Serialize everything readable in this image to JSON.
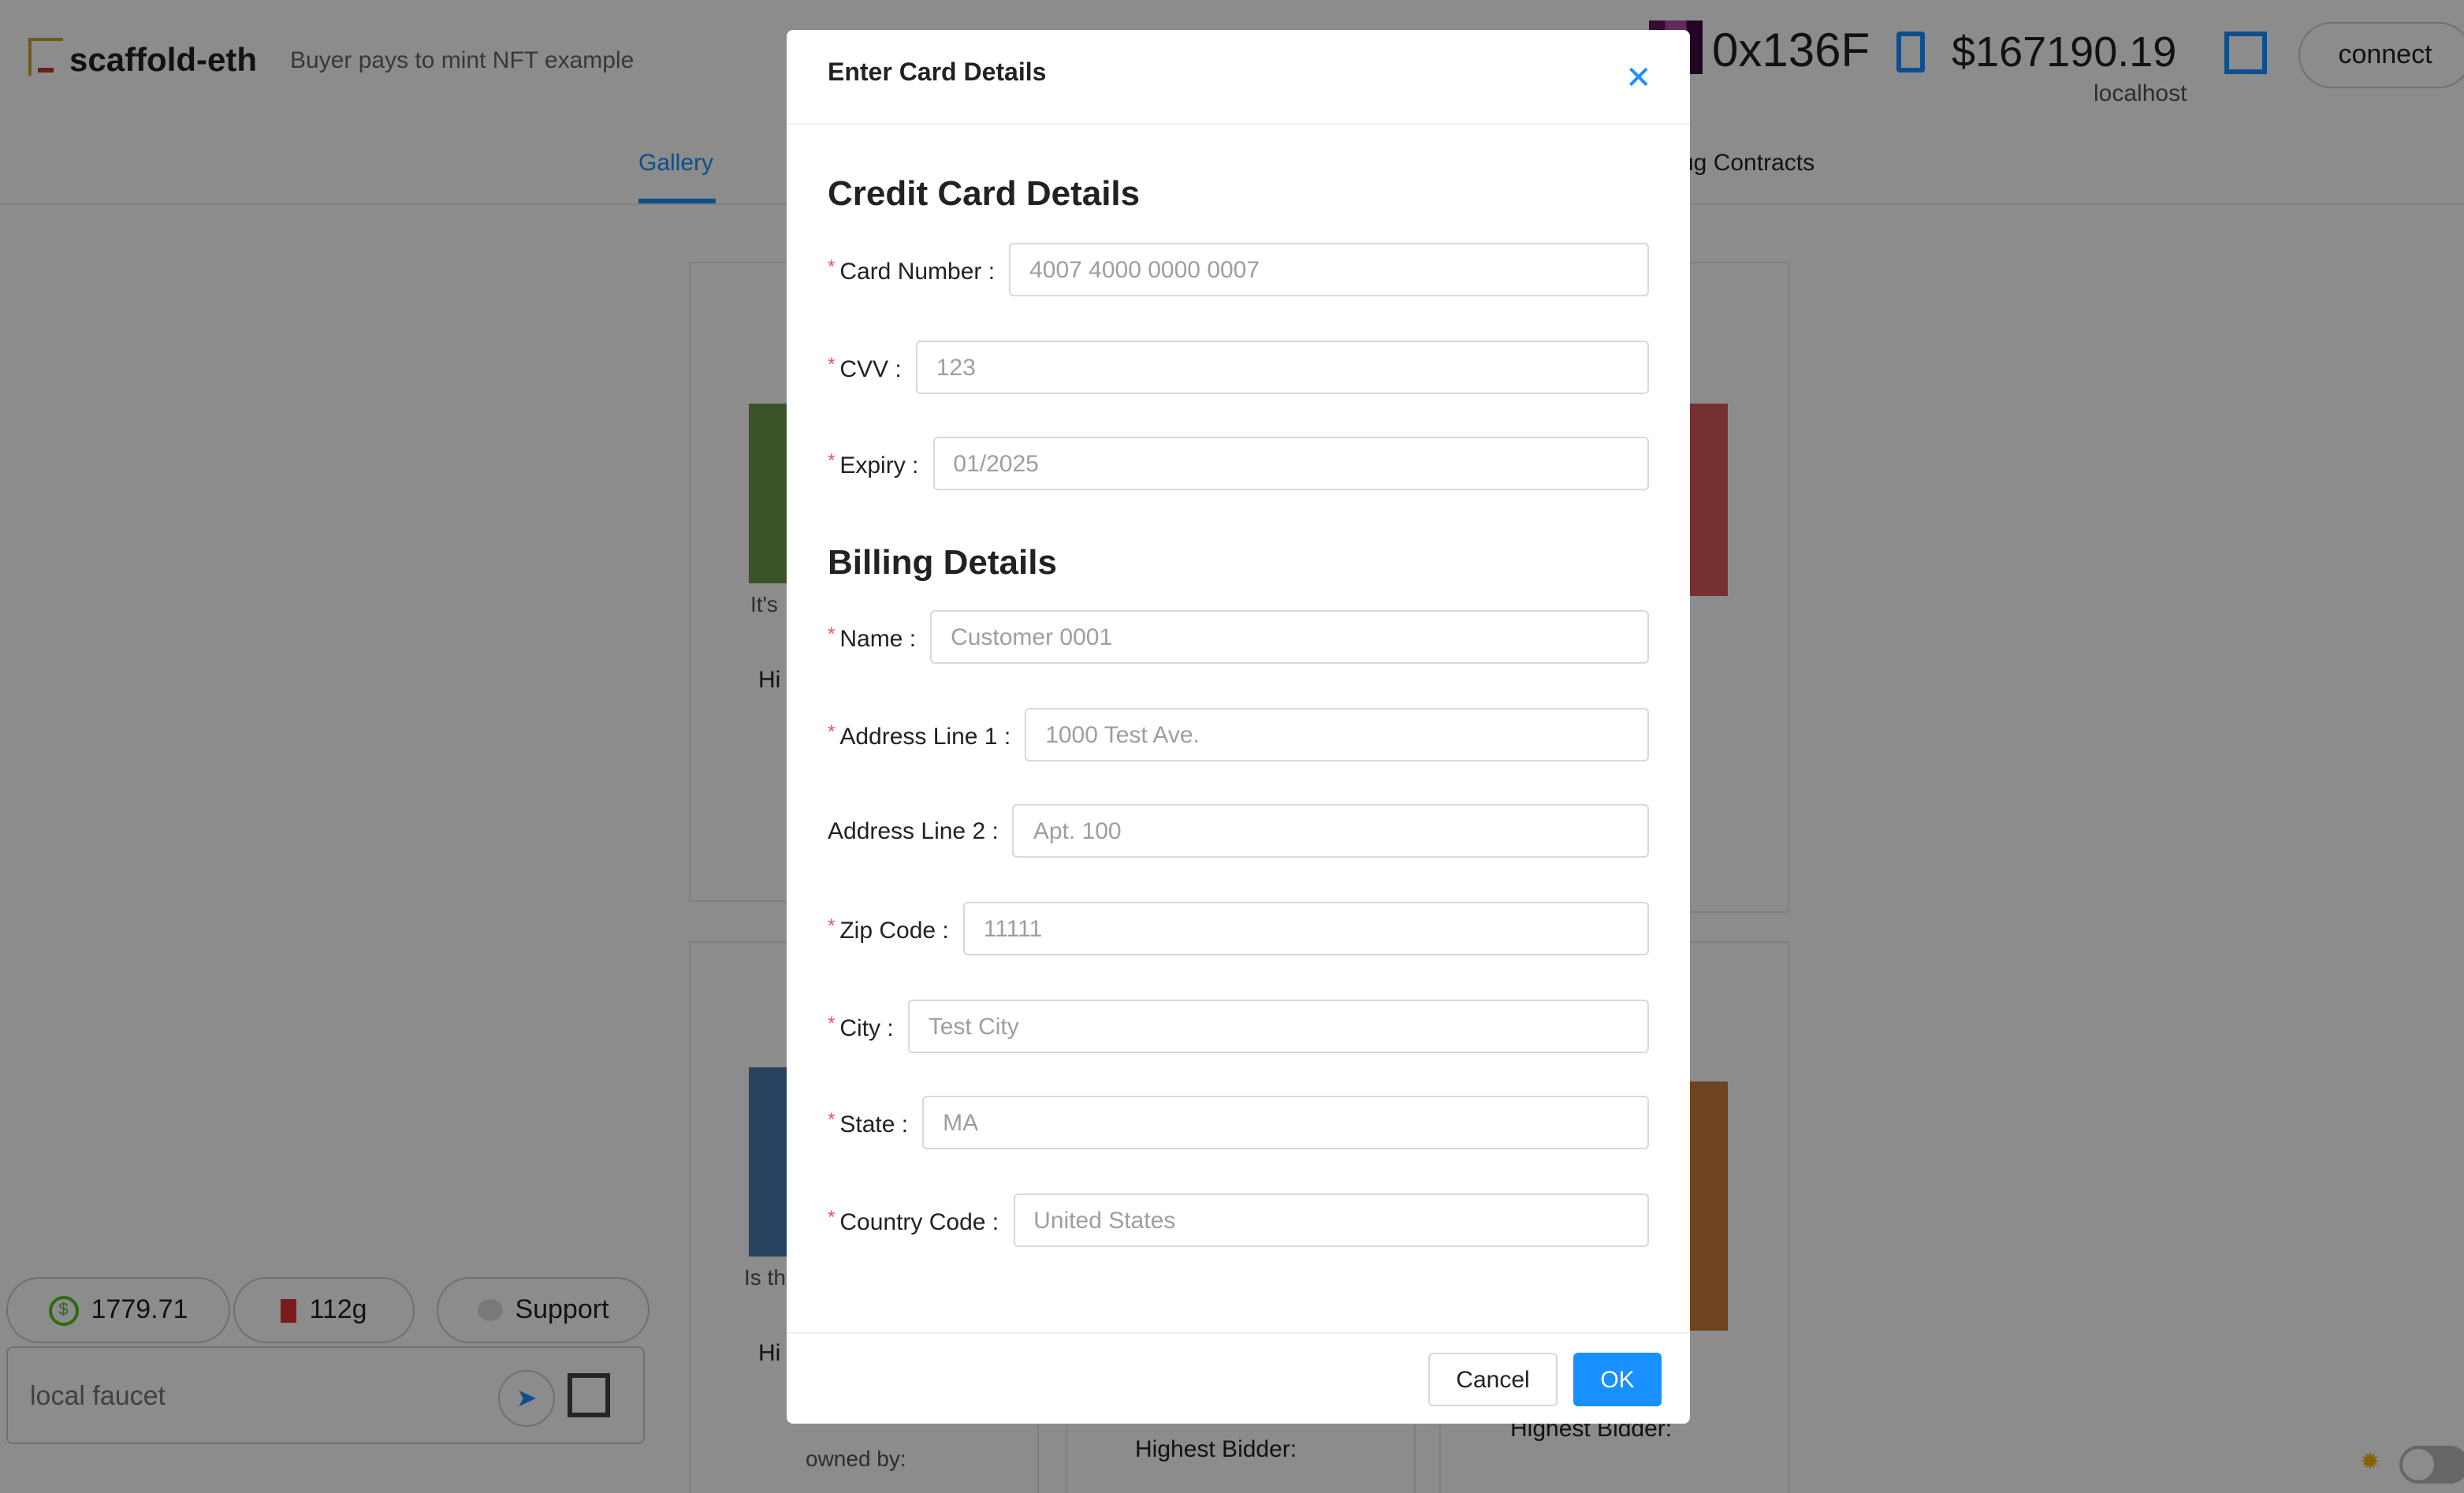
{
  "header": {
    "brand": "scaffold-eth",
    "subtitle": "Buyer pays to mint NFT example",
    "address": "0x136F",
    "balance": "$167190.19",
    "network": "localhost",
    "connect_label": "connect"
  },
  "tabs": [
    {
      "label": "Gallery",
      "active": true
    },
    {
      "label": "ug Contracts",
      "active": false
    }
  ],
  "gallery": {
    "snippets": [
      "It's",
      "Hi",
      "Is th",
      "Hi",
      "owned by:",
      "Highest Bidder:",
      "Highest Bidder:"
    ]
  },
  "footer_widgets": {
    "price": "1779.71",
    "gas": "112g",
    "support_label": "Support",
    "faucet_placeholder": "local faucet"
  },
  "modal": {
    "title": "Enter Card Details",
    "credit_heading": "Credit Card Details",
    "billing_heading": "Billing Details",
    "fields": [
      {
        "label": "Card Number",
        "placeholder": "4007 4000 0000 0007",
        "required": true
      },
      {
        "label": "CVV",
        "placeholder": "123",
        "required": true
      },
      {
        "label": "Expiry",
        "placeholder": "01/2025",
        "required": true
      },
      {
        "label": "Name",
        "placeholder": "Customer 0001",
        "required": true
      },
      {
        "label": "Address Line 1",
        "placeholder": "1000 Test Ave.",
        "required": true
      },
      {
        "label": "Address Line 2",
        "placeholder": "Apt. 100",
        "required": false
      },
      {
        "label": "Zip Code",
        "placeholder": "11111",
        "required": true
      },
      {
        "label": "City",
        "placeholder": "Test City",
        "required": true
      },
      {
        "label": "State",
        "placeholder": "MA",
        "required": true
      },
      {
        "label": "Country Code",
        "placeholder": "United States",
        "required": true
      }
    ],
    "cancel_label": "Cancel",
    "ok_label": "OK"
  },
  "colors": {
    "accent": "#1890ff",
    "required": "#ff4d4f"
  }
}
